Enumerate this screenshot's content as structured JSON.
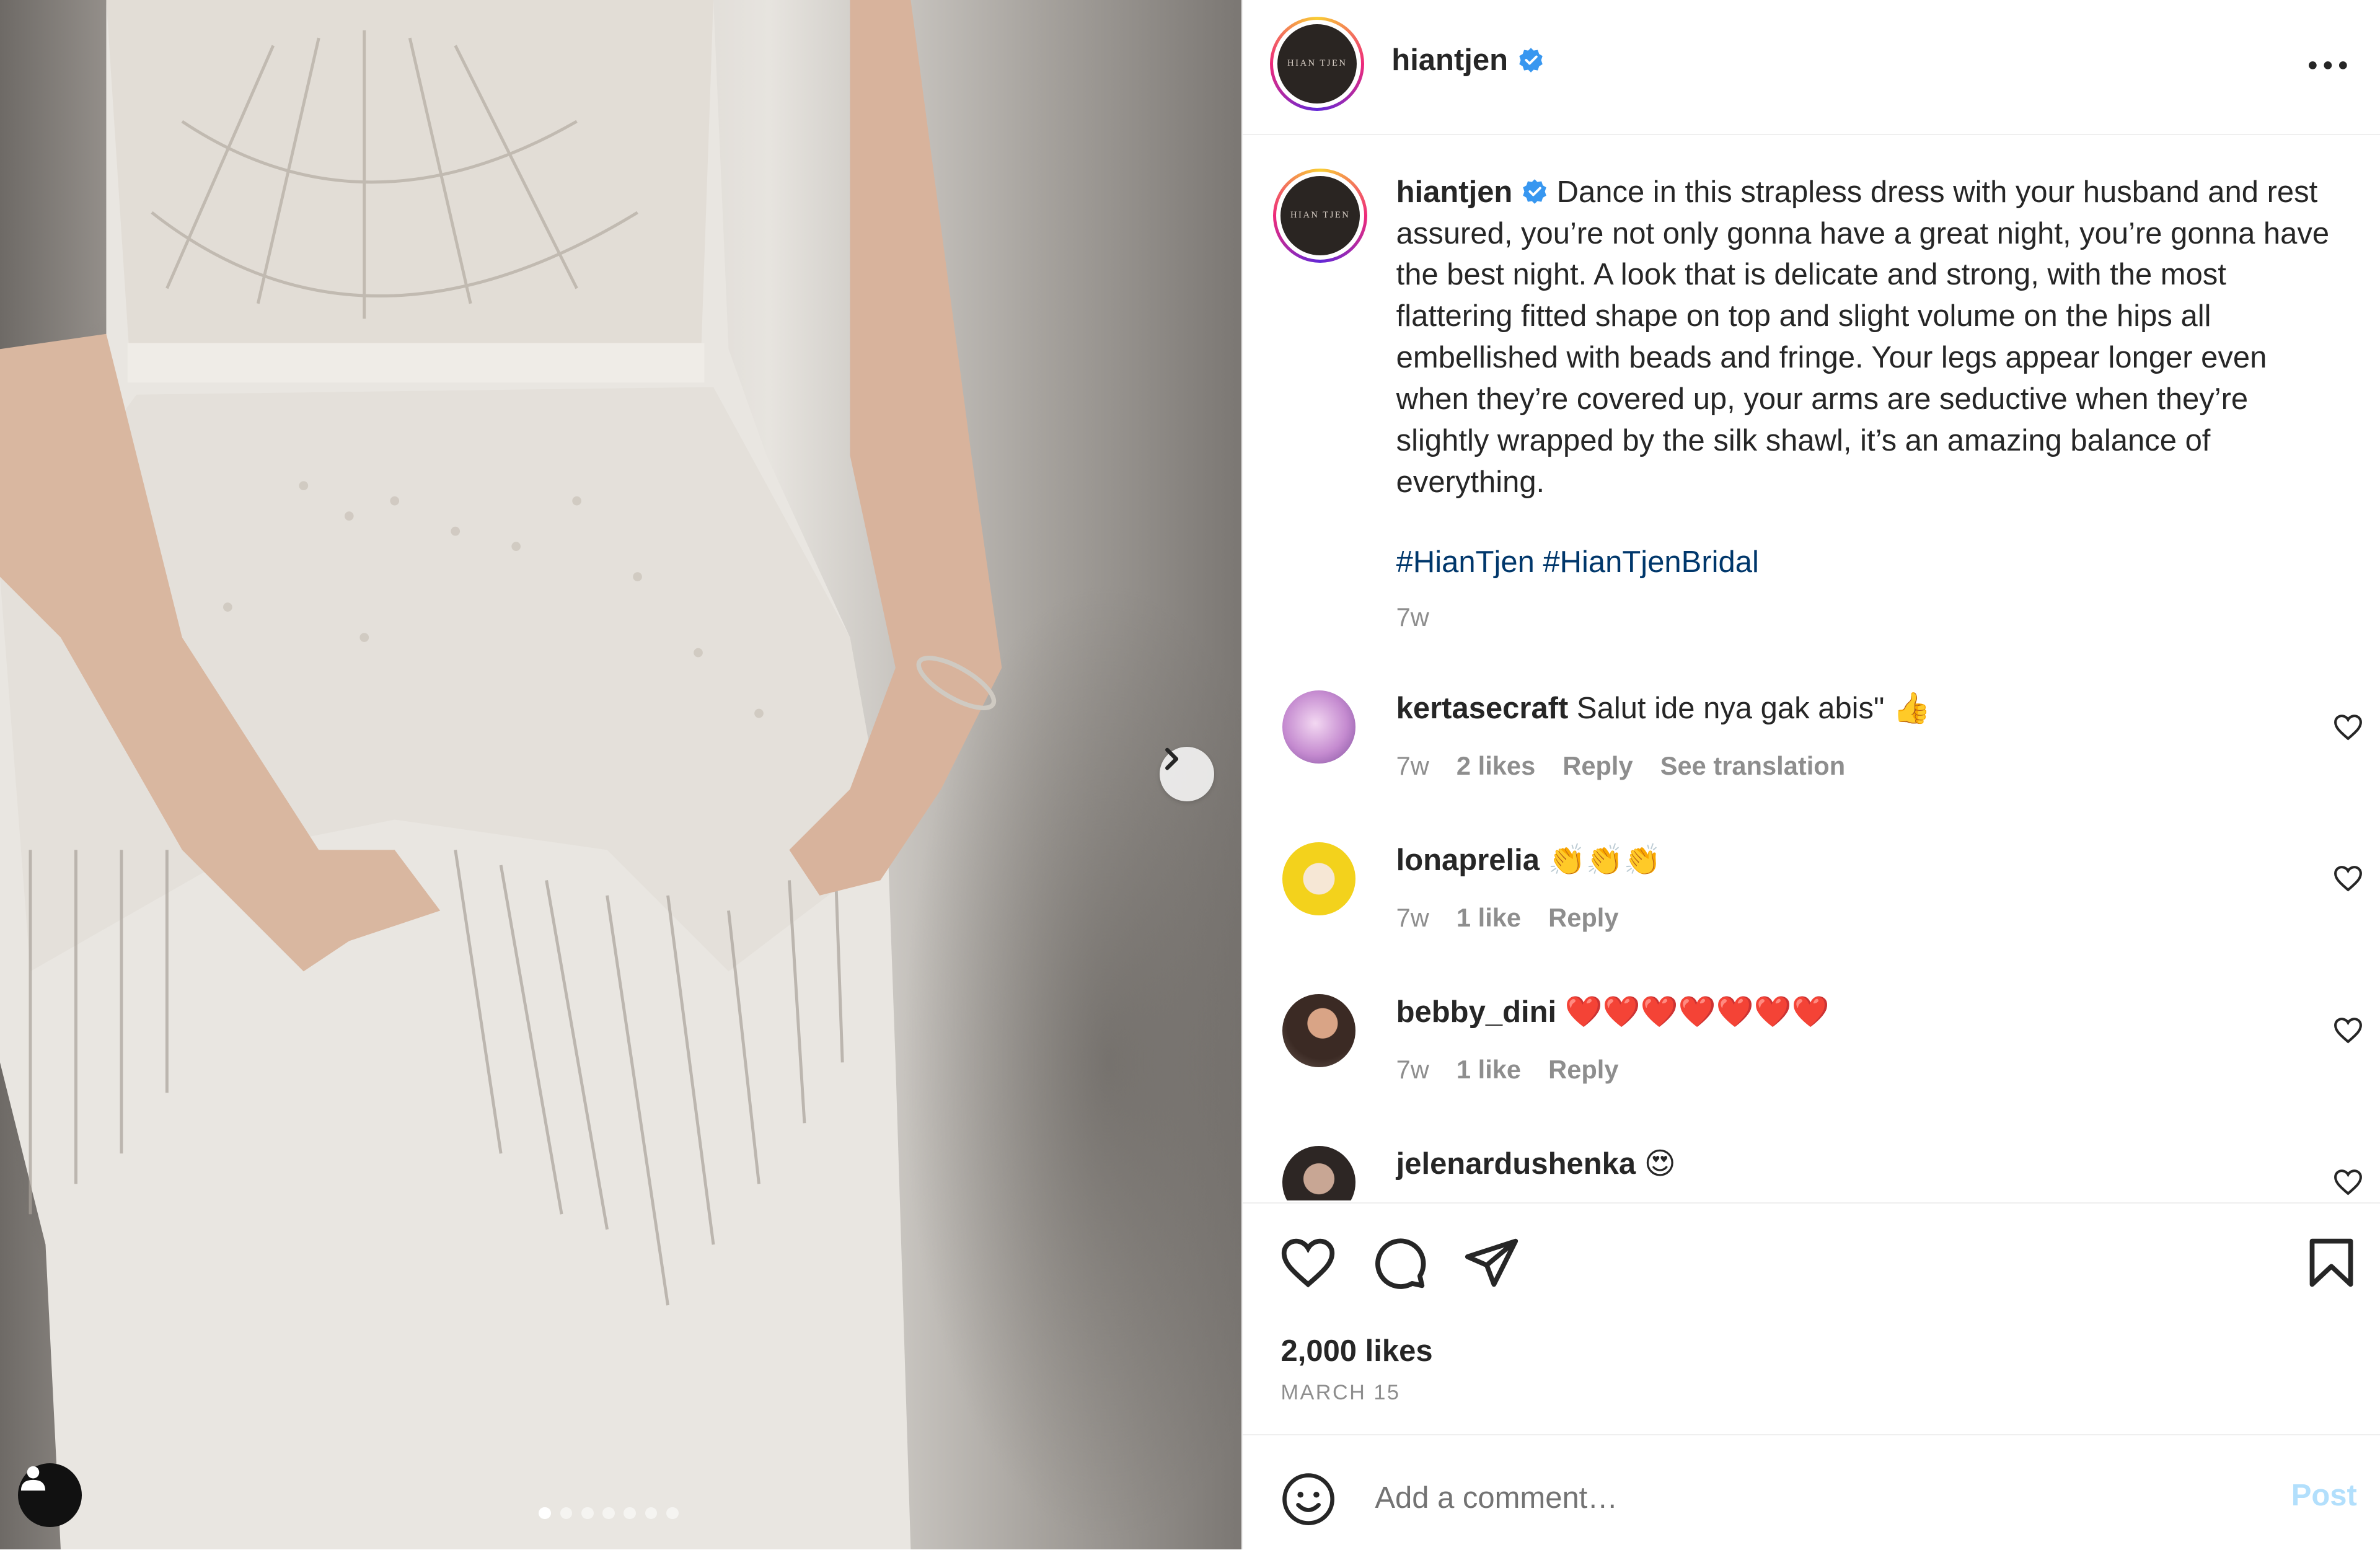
{
  "post": {
    "username": "hiantjen",
    "avatar_text": "HIAN TJEN",
    "caption": "Dance in this strapless dress with your husband and rest assured, you’re not only gonna have a great night, you’re gonna have the best night. A look that is delicate and strong, with the most flattering fitted shape on top and slight volume on the hips all embellished with beads and fringe. Your legs appear longer even when they’re covered up, your arms are seductive when they’re slightly wrapped by the silk shawl, it’s an amazing balance of everything.",
    "hashtags": [
      "#HianTjen",
      "#HianTjenBridal"
    ],
    "caption_time": "7w",
    "likes": "2,000 likes",
    "date": "MARCH 15"
  },
  "carousel": {
    "slide_count": 7,
    "active_index": 0
  },
  "comments": [
    {
      "username": "kertasecraft",
      "text": "Salut ide nya gak abis\" 👍",
      "time": "7w",
      "likes": "2 likes",
      "reply": "Reply",
      "translate": "See translation"
    },
    {
      "username": "lonaprelia",
      "text": "👏👏👏",
      "time": "7w",
      "likes": "1 like",
      "reply": "Reply"
    },
    {
      "username": "bebby_dini",
      "text": "❤️❤️❤️❤️❤️❤️❤️",
      "time": "7w",
      "likes": "1 like",
      "reply": "Reply"
    },
    {
      "username": "jelenardushenka",
      "text": "😍"
    }
  ],
  "add_comment": {
    "placeholder": "Add a comment…",
    "post_label": "Post"
  },
  "colors": {
    "link": "#00376b",
    "verified": "#3897f0",
    "post_disabled": "#b2dffc",
    "muted": "#8e8e8e"
  }
}
